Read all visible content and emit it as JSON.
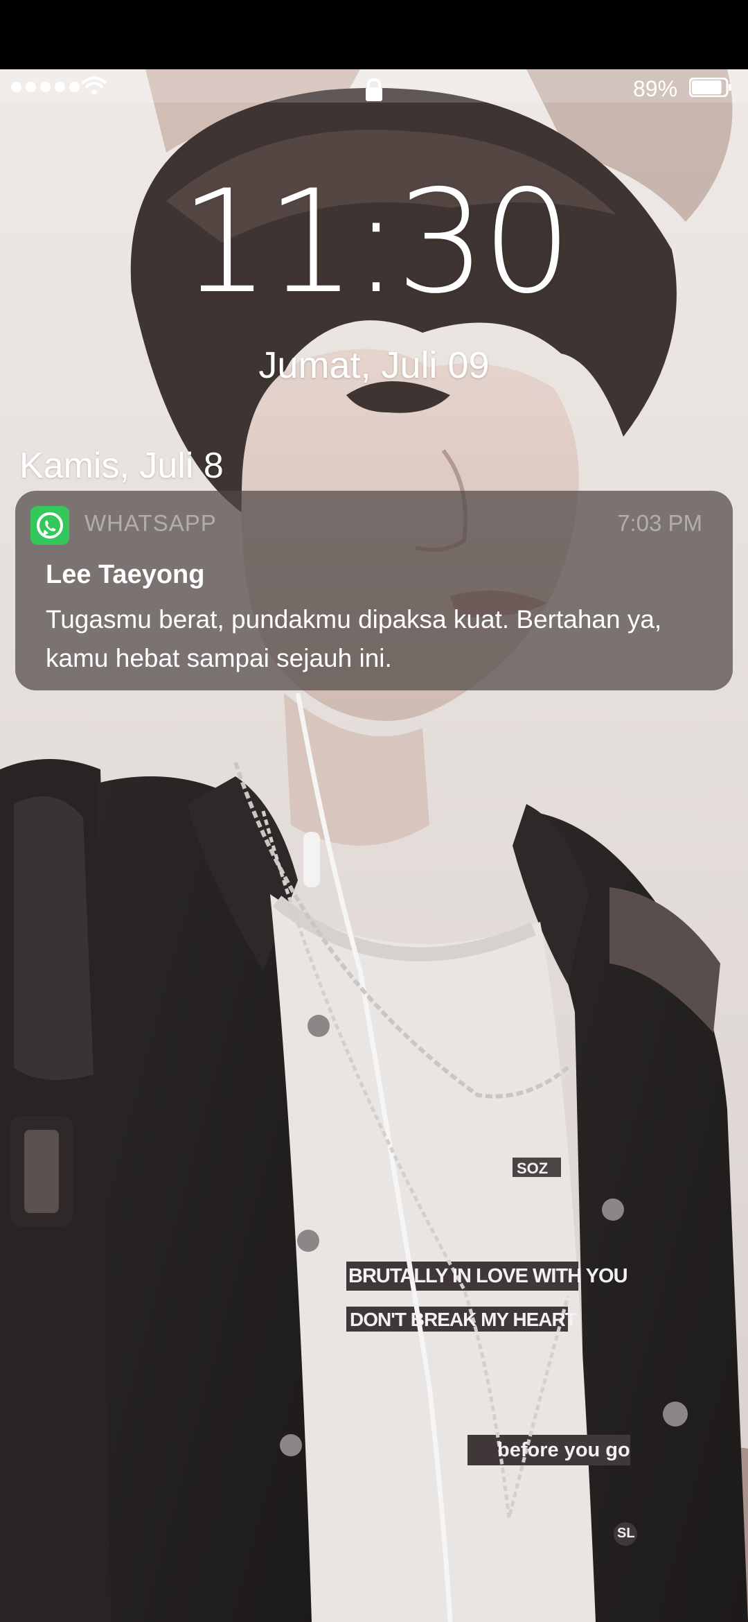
{
  "status_bar": {
    "signal_bars": 5,
    "wifi_icon": "wifi-icon",
    "lock_icon": "lock-icon",
    "battery_percent": "89%",
    "battery_level": 0.89
  },
  "lock_screen": {
    "time": "11:30",
    "date": "Jumat, Juli 09"
  },
  "notifications": {
    "section_date": "Kamis, Juli 8",
    "items": [
      {
        "app_icon": "whatsapp-icon",
        "app_name": "WHATSAPP",
        "time": "7:03 PM",
        "sender": "Lee Taeyong",
        "message": "Tugasmu berat, pundakmu dipaksa kuat. Bertahan ya, kamu hebat sampai sejauh ini."
      }
    ]
  },
  "wallpaper": {
    "shirt_text": [
      "BRUTALLY IN LOVE WITH YOU",
      "DON'T BREAK MY HEART",
      "before you go",
      "SOZ",
      "SL"
    ],
    "colors": {
      "jacket": "#262323",
      "shirt": "#e9e5e2",
      "hair": "#3e3431",
      "skin": "#dcc9c1",
      "accent": "#34c759"
    }
  }
}
